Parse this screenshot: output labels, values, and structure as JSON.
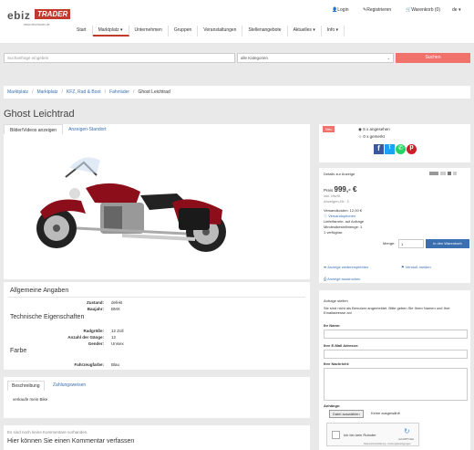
{
  "logo": {
    "brand_a": "ebiz",
    "brand_b": "TRADER",
    "tagline": "www.ebiztrader.de"
  },
  "header": {
    "login": "Login",
    "register": "Registrieren",
    "cart": "Warenkorb (0)",
    "lang": "de"
  },
  "nav": [
    "Start",
    "Marktplatz",
    "Unternehmen",
    "Gruppen",
    "Veranstaltungen",
    "Stellenangebote",
    "Aktuelles",
    "Info"
  ],
  "search": {
    "placeholder": "Suchanfrage eingeben",
    "category": "alle Kategorien",
    "button": "Suchen"
  },
  "breadcrumbs": [
    "Marktplatz",
    "Marktplatz",
    "KFZ, Rad & Boot",
    "Fahrräder",
    "Ghost Leichtrad"
  ],
  "title": "Ghost Leichtrad",
  "tabs": {
    "images": "Bilder/Videos anzeigen",
    "location": "Anzeigen-Standort"
  },
  "general": {
    "heading": "Allgemeine Angaben",
    "rows": [
      {
        "k": "Zustand:",
        "v": "defekt"
      },
      {
        "k": "Baujahr:",
        "v": "BMX"
      }
    ]
  },
  "tech": {
    "heading": "Technische Eigenschaften",
    "rows": [
      {
        "k": "Radgröße:",
        "v": "12 Zoll"
      },
      {
        "k": "Anzahl der Gänge:",
        "v": "12"
      },
      {
        "k": "Gender:",
        "v": "Unisex"
      }
    ]
  },
  "color": {
    "heading": "Farbe",
    "rows": [
      {
        "k": "Fahrzeugfarbe:",
        "v": "Blau"
      }
    ]
  },
  "desc": {
    "tab1": "Beschreibung",
    "tab2": "Zahlungsweisen",
    "text": "verkaufe mein Bike"
  },
  "comments": {
    "none": "Es sind noch keine Kommentare vorhanden.",
    "heading": "Hier können Sie einen Kommentar verfassen"
  },
  "side": {
    "badge": "Neu",
    "views": "6 x angesehen",
    "remembered": "0 x gemerkt"
  },
  "details": {
    "heading": "Details zur Anzeige",
    "price_label": "Preis",
    "price": "999,- €",
    "vat": "inkl. MwSt",
    "ad_no": "Anzeigen-Nr.: 3",
    "shipping": "Versandkosten: 12,00 €",
    "ship_opts": "Versandoptionen",
    "delivery": "Lieferfarrein: auf Anfrage",
    "min_order": "Mindestbestellmenge: 1",
    "available": "1 verfügbar.",
    "qty_label": "Menge:",
    "qty": "1",
    "cart_btn": "in den Warenkorb",
    "recommend": "Anzeige weiterempfehlen",
    "report": "Verstoß melden",
    "print": "Anzeige ausdrucken"
  },
  "inquiry": {
    "heading": "Anfrage stellen",
    "note": "Sie sind nicht als Benutzer angemeldet. Bitte geben Sie Ihren Namen und Ihre Emailadresse an!",
    "name": "Ihr Name:",
    "email": "Ihre E-Mail Adresse:",
    "msg": "Ihre Nachricht:",
    "attach": "Anhänge:",
    "file_btn": "Datei auswählen",
    "file_none": "Keine ausgewählt",
    "captcha": "Ich bin kein Roboter",
    "recaptcha": "reCAPTCHA",
    "privacy": "Datenschutzerklärung - Nutzungsbedingungen"
  }
}
